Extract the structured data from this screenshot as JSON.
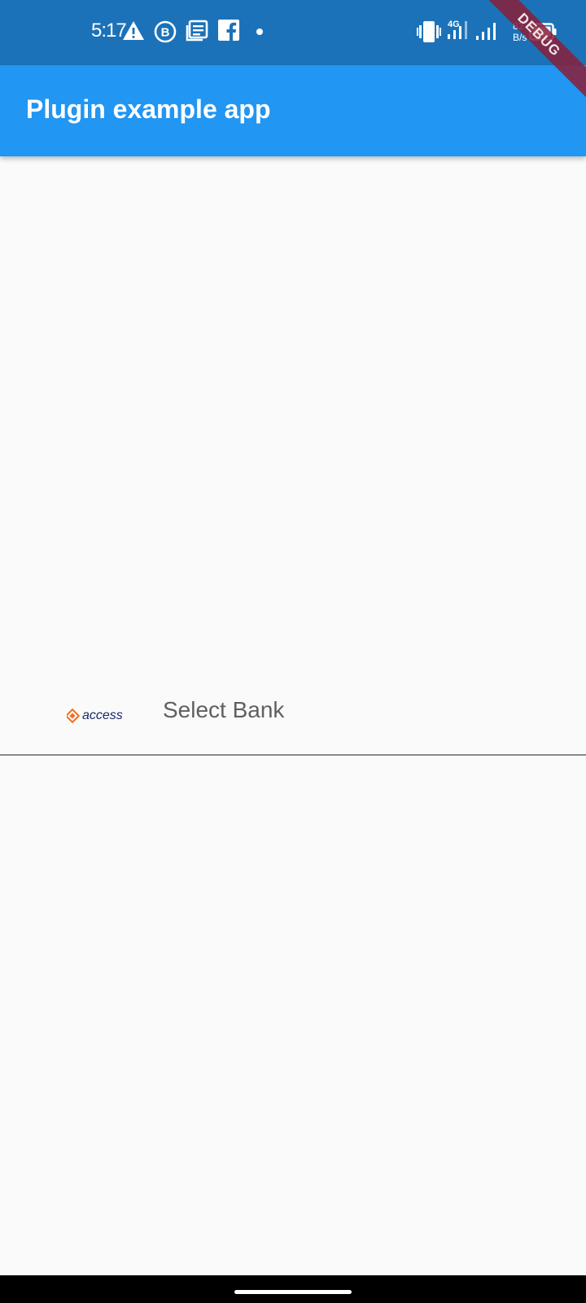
{
  "status_bar": {
    "time": "5:17",
    "icons_left": [
      "warning-icon",
      "b-circle-icon",
      "news-icon",
      "facebook-icon",
      "dot-icon"
    ],
    "icons_right": [
      "vibrate-icon",
      "signal-4g-icon",
      "signal-icon",
      "battery-icon"
    ],
    "net_speed_value": "82",
    "net_speed_unit": "B/s",
    "background": "#1c72b9"
  },
  "debug_banner": {
    "label": "DEBUG"
  },
  "app_bar": {
    "title": "Plugin example app",
    "background": "#2196f3"
  },
  "bank_selector": {
    "logo_text": "access",
    "logo_icon": "access-bank-logo",
    "hint": "Select Bank"
  },
  "colors": {
    "page_background": "#fafafa",
    "underline": "#8a8a8a",
    "hint_text": "#606060",
    "access_orange": "#f36f21",
    "access_navy": "#1b2a6b"
  }
}
